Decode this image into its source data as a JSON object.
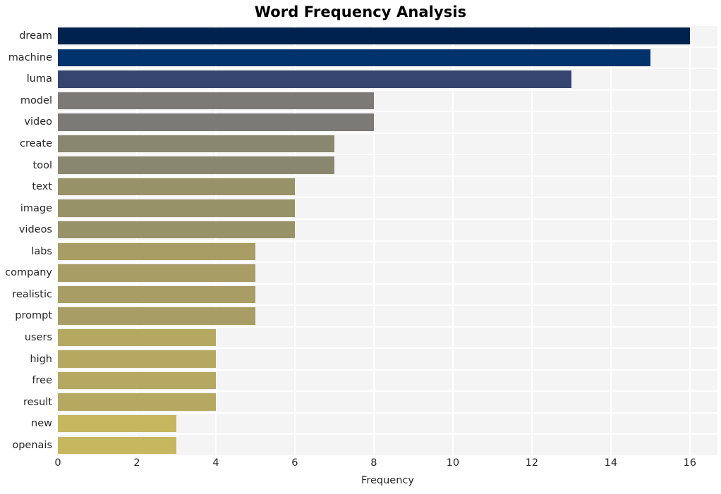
{
  "chart_data": {
    "type": "bar",
    "orientation": "horizontal",
    "title": "Word Frequency Analysis",
    "xlabel": "Frequency",
    "ylabel": "",
    "xlim": [
      0,
      16.7
    ],
    "ylim": null,
    "grid": true,
    "legend": null,
    "xticks": [
      0,
      2,
      4,
      6,
      8,
      10,
      12,
      14,
      16
    ],
    "xtick_labels": [
      "0",
      "2",
      "4",
      "6",
      "8",
      "10",
      "12",
      "14",
      "16"
    ],
    "categories": [
      "dream",
      "machine",
      "luma",
      "model",
      "video",
      "create",
      "tool",
      "text",
      "image",
      "videos",
      "labs",
      "company",
      "realistic",
      "prompt",
      "users",
      "high",
      "free",
      "result",
      "new",
      "openais"
    ],
    "values": [
      16,
      15,
      13,
      8,
      8,
      7,
      7,
      6,
      6,
      6,
      5,
      5,
      5,
      5,
      4,
      4,
      4,
      4,
      3,
      3
    ],
    "colors": [
      "#00224e",
      "#00336c",
      "#36456f",
      "#7b7a77",
      "#7b7a77",
      "#89876f",
      "#89876f",
      "#989269",
      "#989269",
      "#989269",
      "#a79d65",
      "#a79d65",
      "#a79d65",
      "#a79d65",
      "#b5a962",
      "#b5a962",
      "#b5a962",
      "#b5a962",
      "#c6b65e",
      "#c6b65e"
    ],
    "colormap": "cividis",
    "plot_background": "#f4f4f5",
    "grid_color": "#ffffff",
    "figure_background": "#ffffff"
  }
}
